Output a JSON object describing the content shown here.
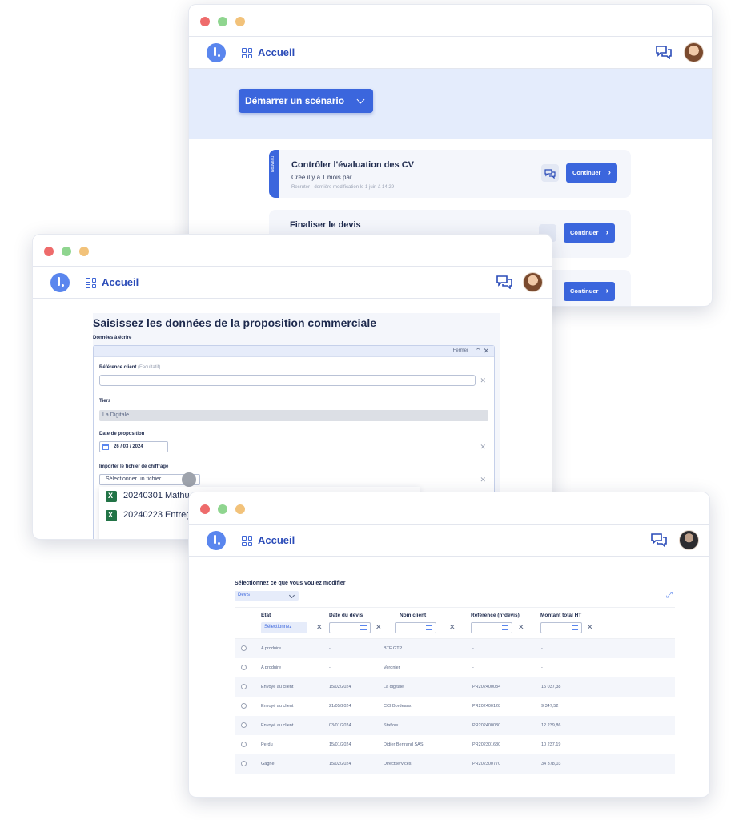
{
  "app_title": "Accueil",
  "window1": {
    "start_button": "Démarrer un scénario",
    "cards": [
      {
        "side_label": "Nouveau",
        "title": "Contrôler l'évaluation des CV",
        "subtitle": "Crée il y a 1 mois par",
        "meta": "Recruter - dernière modification le 1 juin à 14:29",
        "button": "Continuer"
      },
      {
        "title": "Finaliser le devis",
        "button": "Continuer"
      },
      {
        "button": "Continuer"
      }
    ]
  },
  "window2": {
    "title": "Saisissez les données de la proposition commerciale",
    "section": "Données à écrire",
    "close_label": "Fermer",
    "fields": {
      "reference_label": "Référence client",
      "reference_optional": "(Facultatif)",
      "tiers_label": "Tiers",
      "tiers_value": "La Digitale",
      "date_label": "Date de proposition",
      "date_value": "26  /  03  /  2024",
      "import_label": "Importer le fichier de chiffrage",
      "file_button": "Sélectionner un fichier"
    },
    "files": [
      "20240301 Mathu",
      "20240223 Entreg"
    ]
  },
  "window3": {
    "select_label": "Sélectionnez ce que vous voulez modifier",
    "select_value": "Devis",
    "columns": [
      "État",
      "Date du devis",
      "Nom client",
      "Référence (n°devis)",
      "Montant total HT"
    ],
    "state_filter": "Sélectionnez",
    "rows": [
      [
        "A produire",
        "-",
        "BTF GTP",
        "-",
        "-"
      ],
      [
        "A produire",
        "-",
        "Vergnier",
        "-",
        "-"
      ],
      [
        "Envoyé au client",
        "15/02/2024",
        "La digitale",
        "PR202400034",
        "15 037,38"
      ],
      [
        "Envoyé au client",
        "21/05/2024",
        "CCI Bordeaux",
        "PR202400128",
        "9 347,52"
      ],
      [
        "Envoyé au client",
        "03/01/2024",
        "Staflow",
        "PR202400030",
        "12 239,86"
      ],
      [
        "Perdu",
        "15/01/2024",
        "Didier Bertrand SAS",
        "PR202301680",
        "10 237,19"
      ],
      [
        "Gagné",
        "15/02/2024",
        "Directservices",
        "PR202300770",
        "34 378,03"
      ]
    ]
  },
  "colors": {
    "accent": "#3b66dd",
    "banner": "#e4ecfc",
    "card": "#f4f6fb"
  }
}
